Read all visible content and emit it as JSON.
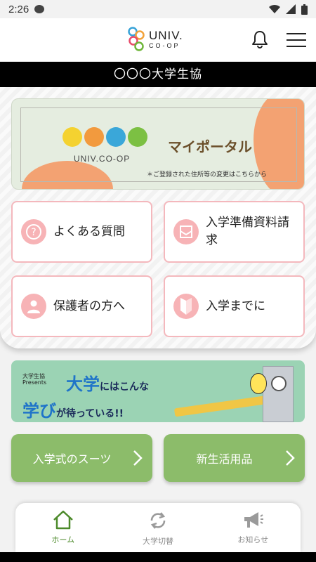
{
  "status_bar": {
    "time": "2:26"
  },
  "app_bar": {
    "logo_main": "UNIV.",
    "logo_sub": "CO-OP",
    "icons": [
      "bell-icon",
      "hamburger-menu-icon"
    ]
  },
  "title": "〇〇〇大学生協",
  "portal": {
    "logo_caption": "UNIV.CO-OP",
    "label": "マイポータル",
    "note": "＊ご登録された住所等の変更はこちらから"
  },
  "tiles": [
    {
      "label": "よくある質問",
      "icon": "question-icon"
    },
    {
      "label": "入学準備資料請求",
      "icon": "document-icon"
    },
    {
      "label": "保護者の方へ",
      "icon": "person-icon"
    },
    {
      "label": "入学までに",
      "icon": "beginner-mark-icon"
    }
  ],
  "banner": {
    "pre": "大学生協\nPresents",
    "big1": "大学",
    "line1": "にはこんな",
    "big2": "学び",
    "line2": "が待っている!!"
  },
  "buttons": {
    "suit": "入学式のスーツ",
    "supplies": "新生活用品"
  },
  "bottom_nav": [
    {
      "label": "ホーム",
      "icon": "home-icon",
      "active": true
    },
    {
      "label": "大学切替",
      "icon": "switch-icon",
      "active": false
    },
    {
      "label": "お知らせ",
      "icon": "megaphone-icon",
      "active": false
    }
  ],
  "colors": {
    "accent_green": "#8cbc6a",
    "tile_border_pink": "#f4b8bd",
    "icon_pink": "#f7b3b6",
    "nav_active": "#4d8a2b",
    "portal_orange": "#f3a272"
  }
}
